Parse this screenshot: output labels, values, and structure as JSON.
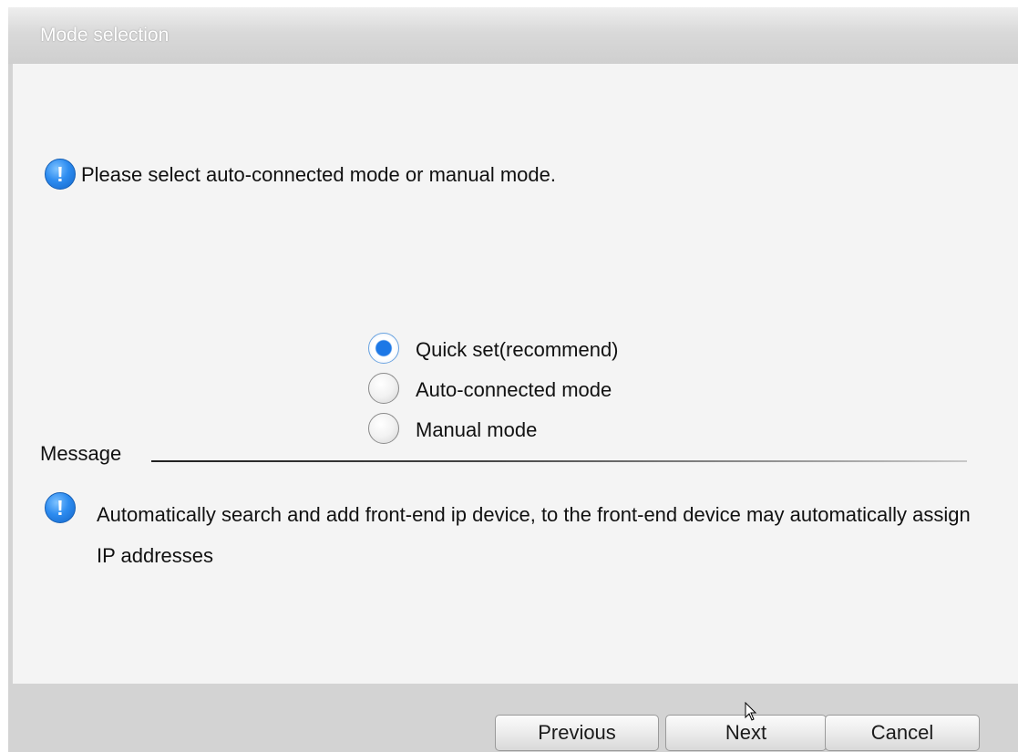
{
  "window": {
    "title": "Mode selection"
  },
  "prompt": {
    "icon": "info-icon",
    "text": "Please select auto-connected mode or manual mode."
  },
  "mode_options": [
    {
      "label": "Quick set(recommend)",
      "selected": true
    },
    {
      "label": "Auto-connected mode",
      "selected": false
    },
    {
      "label": "Manual mode",
      "selected": false
    }
  ],
  "message": {
    "label": "Message",
    "icon": "info-icon",
    "text": "Automatically search and add front-end ip device, to the front-end device may automatically assign IP addresses"
  },
  "buttons": {
    "previous": "Previous",
    "next": "Next",
    "cancel": "Cancel"
  },
  "colors": {
    "accent": "#1d78e6",
    "content_bg": "#f4f4f4",
    "chrome_bg": "#d3d3d3"
  }
}
